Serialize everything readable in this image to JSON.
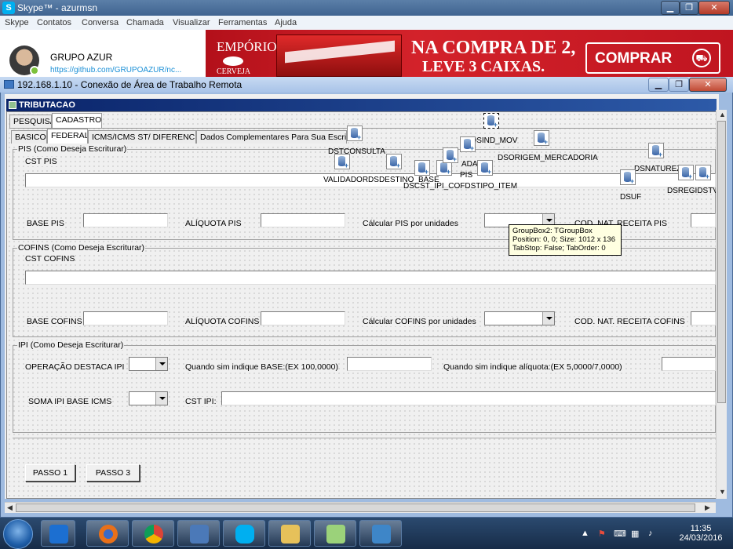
{
  "skype": {
    "title": "Skype™ - azurmsn",
    "menu": [
      "Skype",
      "Contatos",
      "Conversa",
      "Chamada",
      "Visualizar",
      "Ferramentas",
      "Ajuda"
    ],
    "profile_name": "GRUPO AZUR",
    "profile_link": "https://github.com/GRUPOAZUR/nc...",
    "ad": {
      "brand": "EMPÓRIO",
      "brand_sub": "CERVEJA",
      "headline_1": "NA COMPRA DE 2,",
      "headline_2": "LEVE 3 CAIXAS.",
      "button": "COMPRAR"
    }
  },
  "rdp": {
    "title": "192.168.1.10 - Conexão de Área de Trabalho Remota"
  },
  "form": {
    "title": "TRIBUTACAO",
    "top_tabs": [
      "PESQUISA",
      "CADASTRO"
    ],
    "sub_tabs": [
      "BASICO",
      "FEDERAL",
      "ICMS/ICMS ST/ DIFERENCIAL",
      "Dados Complementares Para Sua Escritura"
    ],
    "pis": {
      "group": "PIS (Como Deseja Escriturar)",
      "cst": "CST PIS",
      "base": "BASE PIS",
      "aliquota": "ALÍQUOTA PIS",
      "calc": "Cálcular PIS por unidades",
      "cod_nat": "COD. NAT. RECEITA PIS"
    },
    "cofins": {
      "group": "COFINS (Como Deseja Escriturar)",
      "cst": "CST COFINS",
      "base": "BASE COFINS",
      "aliquota": "ALÍQUOTA COFINS",
      "calc": "Cálcular COFINS por unidades",
      "cod_nat": "COD. NAT. RECEITA COFINS"
    },
    "ipi": {
      "group": "IPI (Como Deseja Escriturar)",
      "operacao": "OPERAÇÃO DESTACA IPI",
      "quando_base": "Quando sim indique BASE:(EX 100,0000)",
      "quando_aliq": "Quando sim indique alíquota:(EX 5,0000/7,0000)",
      "soma": "SOMA IPI BASE ICMS",
      "cst": "CST IPI:"
    },
    "buttons": [
      "PASSO 1",
      "PASSO 3"
    ],
    "datasources": [
      "DSTCONSULTA",
      "DSIND_MOV",
      "VALIDADORDSDESTINO_BASE",
      "ADA",
      "PIS",
      "DSORIGEM_MERCADORIA",
      "DSNATUREZA",
      "DSCST_IPI_COFDSTIPO_ITEM",
      "DSUF",
      "DSREGIDSTV"
    ],
    "tooltip": [
      "GroupBox2: TGroupBox",
      "Position: 0, 0; Size: 1012 x 136",
      "TabStop: False; TabOrder: 0"
    ]
  },
  "taskbar": {
    "time": "11:35",
    "date": "24/03/2016"
  }
}
